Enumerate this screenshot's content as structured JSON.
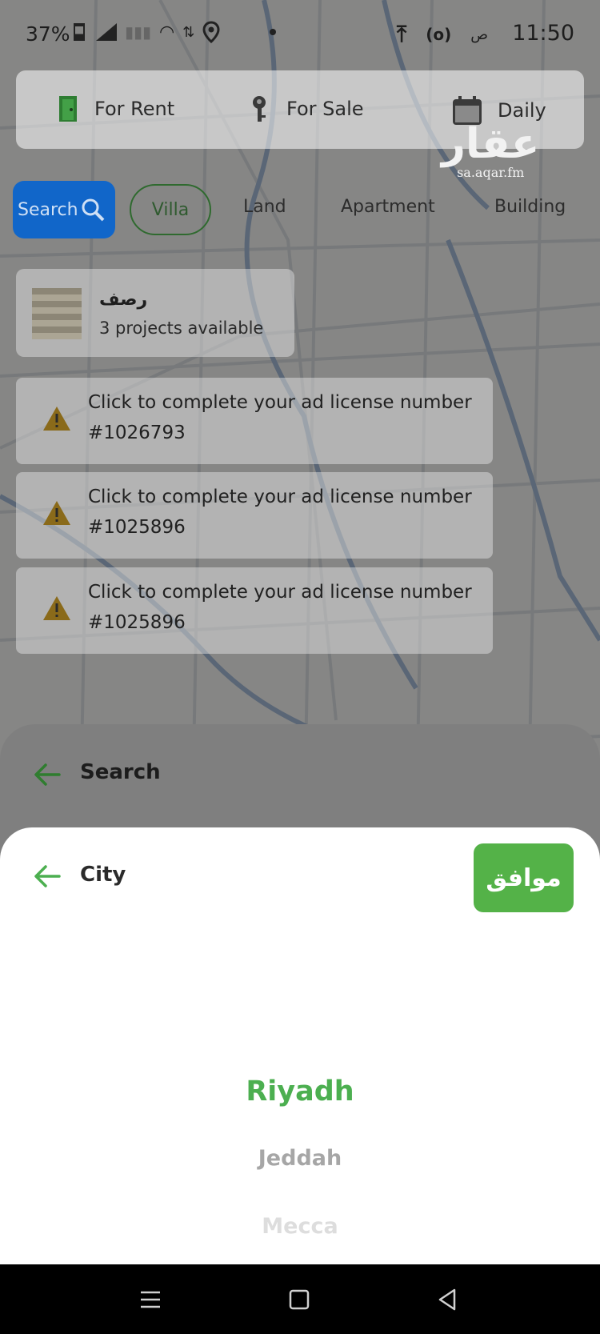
{
  "status_bar": {
    "battery": "37%",
    "time": "11:50",
    "ampm": "ص"
  },
  "listing_types": [
    {
      "label": "For Rent",
      "icon": "door-icon"
    },
    {
      "label": "For Sale",
      "icon": "key-icon"
    },
    {
      "label": "Daily",
      "icon": "calendar-icon"
    }
  ],
  "logo": {
    "arabic": "عقار",
    "url": "sa.aqar.fm"
  },
  "categories": {
    "search_label": "Search",
    "items": [
      "Villa",
      "Land",
      "Apartment",
      "Building"
    ]
  },
  "project_card": {
    "name": "رصف",
    "subtitle": "3 projects available"
  },
  "license_notices": [
    {
      "message": "Click to complete your ad license number",
      "number": "#1026793"
    },
    {
      "message": "Click to complete your ad license number",
      "number": "#1025896"
    },
    {
      "message": "Click to complete your ad license number",
      "number": "#1025896"
    }
  ],
  "search_sheet": {
    "title": "Search"
  },
  "city_sheet": {
    "title": "City",
    "confirm_label": "موافق",
    "options": [
      "Riyadh",
      "Jeddah",
      "Mecca"
    ],
    "selected": "Riyadh"
  },
  "colors": {
    "accent_green": "#54b248",
    "selected_text": "#4caf50",
    "search_chip_blue": "#1166c9",
    "warning_amber": "#8a6a1a"
  }
}
